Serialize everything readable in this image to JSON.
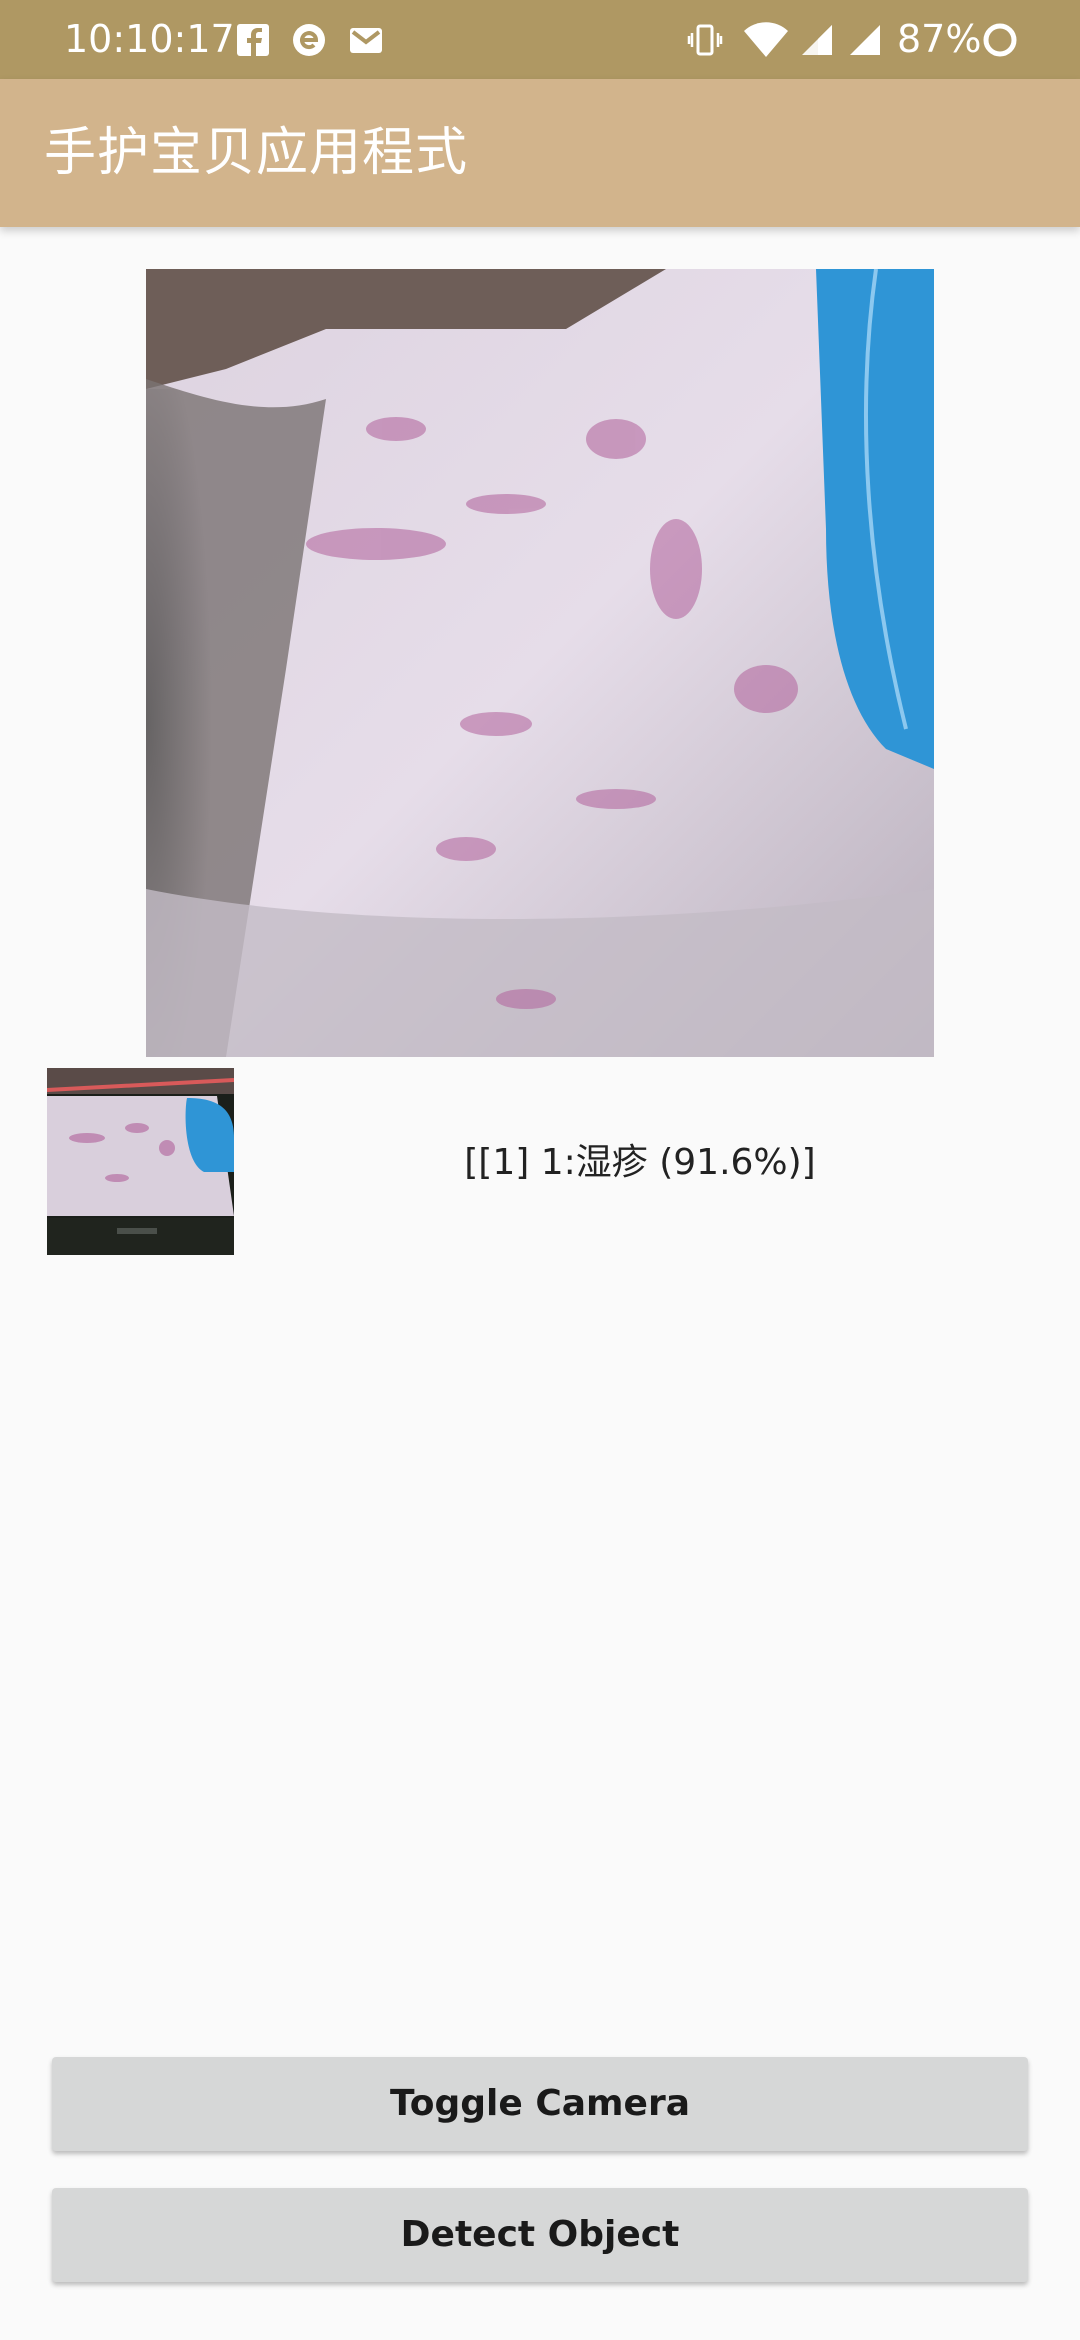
{
  "status_bar": {
    "time": "10:10:17",
    "battery_percent": "87%",
    "left_icons": [
      "facebook-icon",
      "refresh-e-icon",
      "gmail-icon"
    ],
    "right_icons": [
      "vibrate-icon",
      "wifi-icon",
      "signal-icon",
      "signal-icon",
      "battery-ring-icon"
    ],
    "battery_level": 0.87
  },
  "app_bar": {
    "title": "手护宝贝应用程式"
  },
  "result": {
    "text": "[[1] 1:湿疹 (91.6%)]"
  },
  "buttons": {
    "toggle_camera": "Toggle Camera",
    "detect_object": "Detect Object"
  },
  "colors": {
    "status_bar": "#af9863",
    "app_bar": "#d2b48c",
    "background": "#fafafa",
    "button": "#d6d7d7"
  }
}
